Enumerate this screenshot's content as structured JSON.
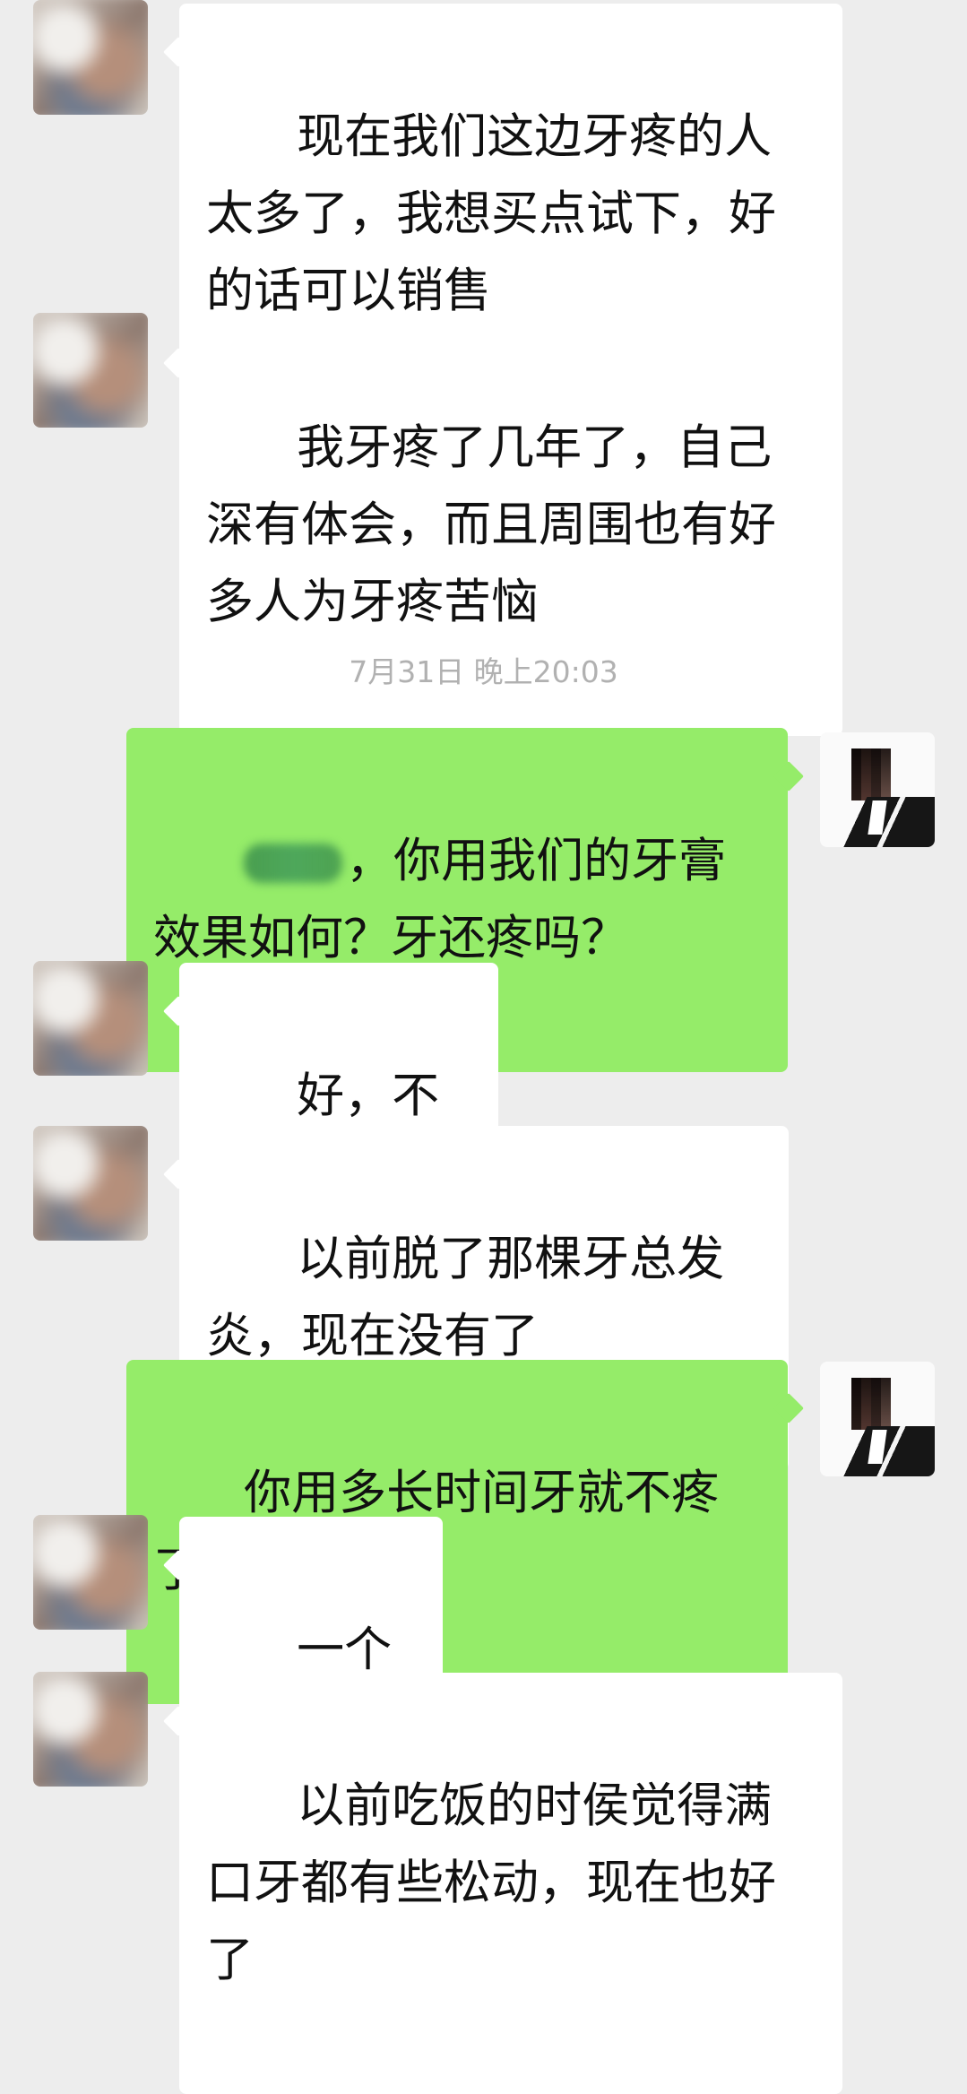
{
  "messages": [
    {
      "side": "left",
      "text": "现在我们这边牙疼的人太多了，我想买点试下，好的话可以销售"
    },
    {
      "side": "left",
      "text": "我牙疼了几年了，自己深有体会，而且周围也有好多人为牙疼苦恼"
    },
    {
      "type": "timestamp",
      "text": "7月31日 晚上20:03"
    },
    {
      "side": "right",
      "text": "，你用我们的牙膏效果如何？牙还疼吗？"
    },
    {
      "side": "left",
      "text": "好，不疼了"
    },
    {
      "side": "left",
      "text": "以前脱了那棵牙总发炎，现在没有了"
    },
    {
      "side": "right",
      "text": "你用多长时间牙就不疼了？"
    },
    {
      "side": "left",
      "text": "一个星期"
    },
    {
      "side": "left",
      "text": "以前吃饭的时侯觉得满口牙都有些松动，现在也好了"
    }
  ],
  "colors": {
    "background": "#ededed",
    "incoming_bubble": "#ffffff",
    "outgoing_bubble": "#95ec69",
    "timestamp": "#b1b1b1",
    "text": "#111111"
  }
}
